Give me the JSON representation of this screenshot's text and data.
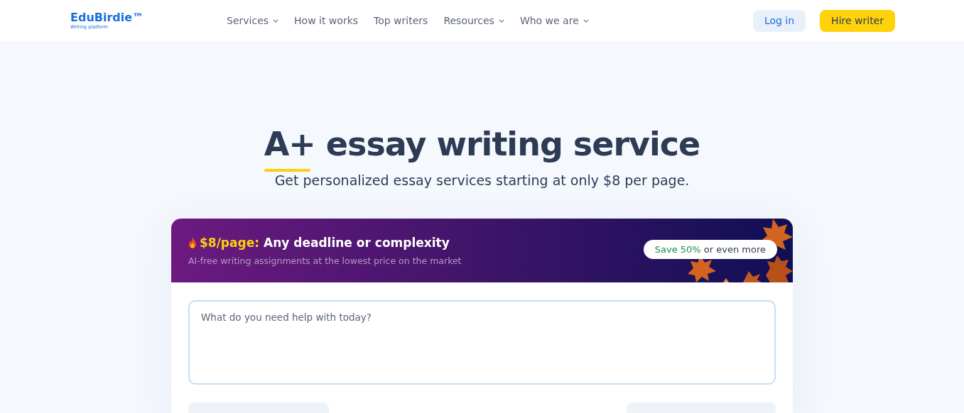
{
  "header": {
    "logo": "EduBirdie™",
    "tagline": "Writing platform",
    "nav": [
      {
        "label": "Services",
        "dropdown": true
      },
      {
        "label": "How it works",
        "dropdown": false
      },
      {
        "label": "Top writers",
        "dropdown": false
      },
      {
        "label": "Resources",
        "dropdown": true
      },
      {
        "label": "Who we are",
        "dropdown": true
      }
    ],
    "login": "Log in",
    "hire": "Hire writer"
  },
  "hero": {
    "title": "A+ essay writing service",
    "subtitle": "Get personalized essay services starting at only $8 per page."
  },
  "offer": {
    "price": "$8/page:",
    "headline": "Any deadline or complexity",
    "description": "AI-free writing assignments at the lowest price on the market",
    "save_highlight": "Save 50%",
    "save_rest": "or even more"
  },
  "form": {
    "placeholder": "What do you need help with today?"
  }
}
